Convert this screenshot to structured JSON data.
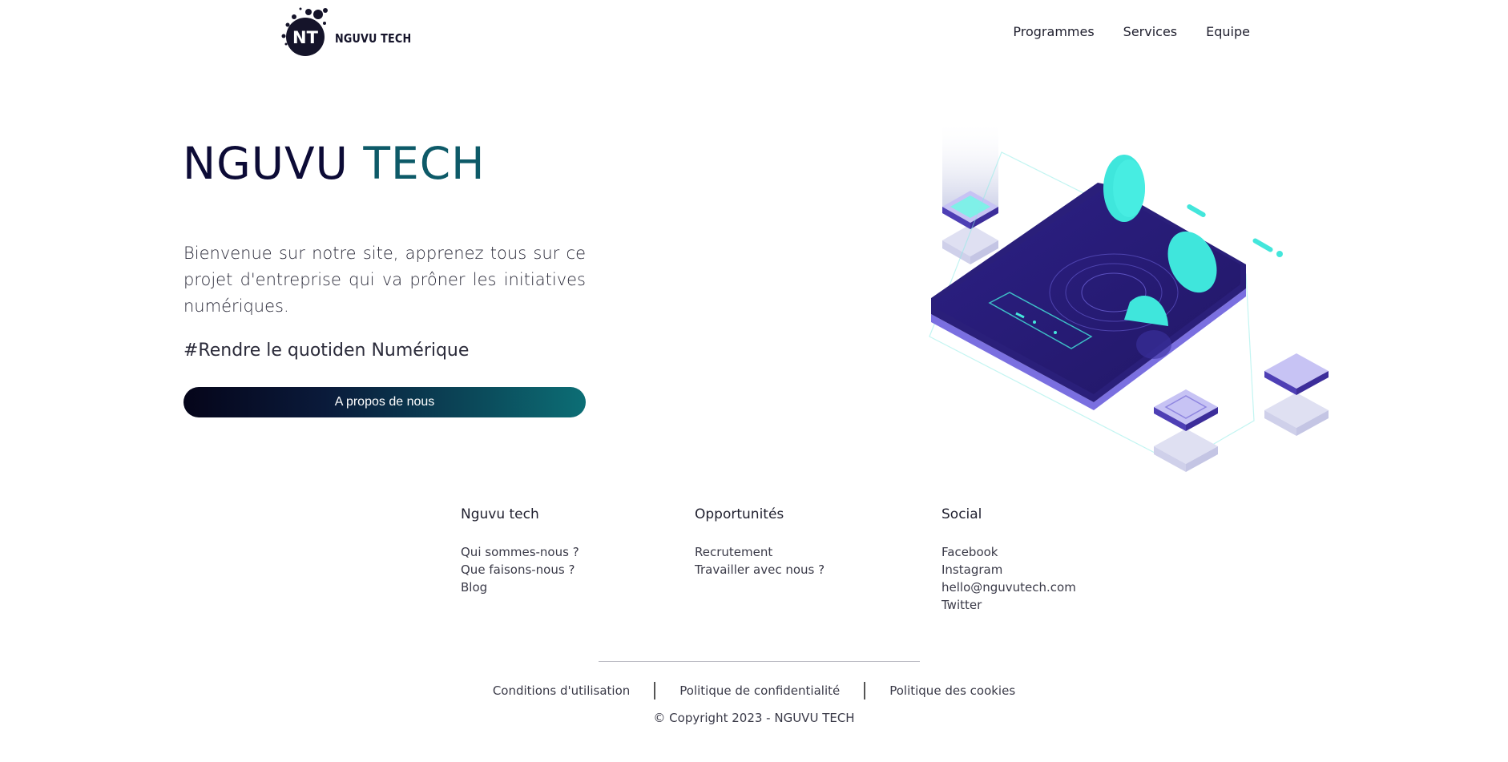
{
  "brand": {
    "logo_monogram": "NT",
    "logo_text": "NGUVU TECH"
  },
  "nav": {
    "items": [
      "Programmes",
      "Services",
      "Equipe"
    ]
  },
  "hero": {
    "title_part1": "NGUVU",
    "title_part2": "TECH",
    "description": "Bienvenue sur notre site, apprenez tous sur ce projet d'entreprise qui va prôner les initiatives numériques.",
    "hashtag": "#Rendre le quotiden Numérique",
    "button_label": "A propos de nous"
  },
  "footer": {
    "columns": [
      {
        "title": "Nguvu tech",
        "links": [
          "Qui sommes-nous ?",
          "Que faisons-nous ?",
          "Blog"
        ]
      },
      {
        "title": "Opportunités",
        "links": [
          "Recrutement",
          "Travailler avec nous ?"
        ]
      },
      {
        "title": "Social",
        "links": [
          "Facebook",
          "Instagram",
          "hello@nguvutech.com",
          "Twitter"
        ]
      }
    ],
    "legal_links": [
      "Conditions d'utilisation",
      "Politique de confidentialité",
      "Politique des cookies"
    ],
    "copyright": "© Copyright 2023 - NGUVU TECH"
  },
  "colors": {
    "title_dark": "#0c0b36",
    "title_teal": "#0d5a68",
    "button_gradient_start": "#05051a",
    "button_gradient_end": "#0c6e75",
    "phone_body": "#2a1f7a",
    "accent_cyan": "#3fe6dc"
  },
  "icons": {
    "logo": "nt-splash-logo-icon",
    "illustration": "isometric-phone-illustration"
  }
}
